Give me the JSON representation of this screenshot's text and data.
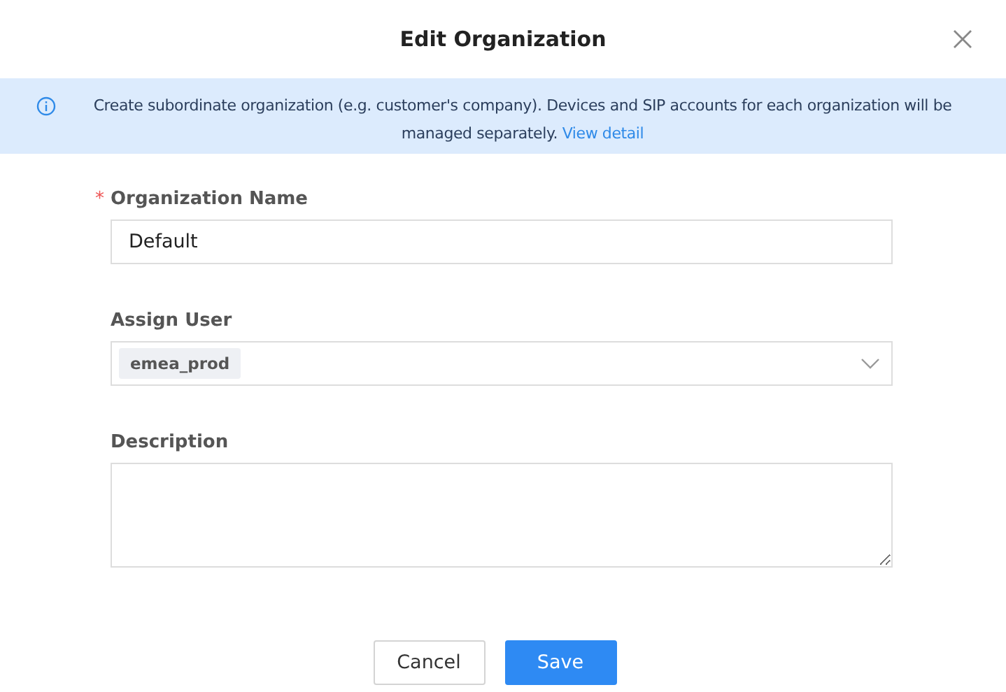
{
  "dialog": {
    "title": "Edit Organization"
  },
  "notice": {
    "text": "Create subordinate organization (e.g. customer's company). Devices and SIP accounts for each organization will be managed separately.",
    "link": "View detail"
  },
  "fields": [
    {
      "kind": "text",
      "required_mark": "*",
      "label": "Organization Name",
      "value": "Default"
    },
    {
      "kind": "select",
      "label": "Assign User",
      "tags": [
        "emea_prod"
      ]
    },
    {
      "kind": "textarea",
      "label": "Description"
    }
  ],
  "buttons": [
    {
      "label": "Cancel",
      "kind": "secondary"
    },
    {
      "label": "Save",
      "kind": "primary"
    }
  ]
}
